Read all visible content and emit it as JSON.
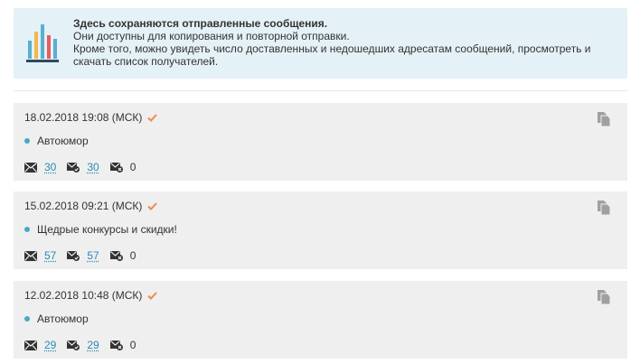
{
  "info": {
    "title": "Здесь сохраняются отправленные сообщения.",
    "line1": "Они доступны для копирования и повторной отправки.",
    "line2": "Кроме того, можно увидеть число доставленных и недошедших адресатам сообщений, просмотреть и",
    "line3": "скачать список получателей.",
    "logo_icon": "bar-chart-icon",
    "colors": {
      "background": "#e4f1f6",
      "bars": [
        "#5aaed0",
        "#f0b84d",
        "#5aaed0",
        "#e85c5c",
        "#5aaed0"
      ],
      "baseline": "#2d4a63"
    }
  },
  "messages": [
    {
      "datetime": "18.02.2018 19:08 (МСК)",
      "status_icon": "check-icon",
      "name": "Автоюмор",
      "sent": "30",
      "delivered": "30",
      "failed": "0"
    },
    {
      "datetime": "15.02.2018 09:21 (МСК)",
      "status_icon": "check-icon",
      "name": "Щедрые конкурсы и скидки!",
      "sent": "57",
      "delivered": "57",
      "failed": "0"
    },
    {
      "datetime": "12.02.2018 10:48 (МСК)",
      "status_icon": "check-icon",
      "name": "Автоюмор",
      "sent": "29",
      "delivered": "29",
      "failed": "0"
    }
  ],
  "colors": {
    "card_bg": "#efefef",
    "link": "#2a8ab6",
    "check": "#f08a4b",
    "dot": "#4aa8c6",
    "icon": "#333333",
    "copy_icon": "#a0a0a0"
  }
}
